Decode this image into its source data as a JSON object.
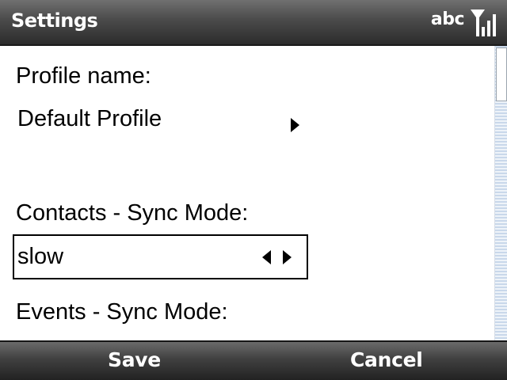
{
  "title_bar": {
    "title": "Settings",
    "input_mode": "abc"
  },
  "form": {
    "profile_name_label": "Profile name:",
    "profile_name_value": "Default Profile",
    "contacts_sync_label": "Contacts - Sync Mode:",
    "contacts_sync_value": "slow",
    "events_sync_label": "Events - Sync Mode:"
  },
  "softkeys": {
    "left": "Save",
    "right": "Cancel"
  },
  "icons": {
    "signal": "signal-strength-icon",
    "profile_arrow": "arrow-right-icon",
    "spinner_left": "arrow-left-icon",
    "spinner_right": "arrow-right-icon"
  },
  "colors": {
    "bar_top": "#707070",
    "bar_bottom": "#2c2c2c",
    "text": "#000000",
    "bar_text": "#ffffff",
    "scrollbar": "#c9d8ea"
  }
}
